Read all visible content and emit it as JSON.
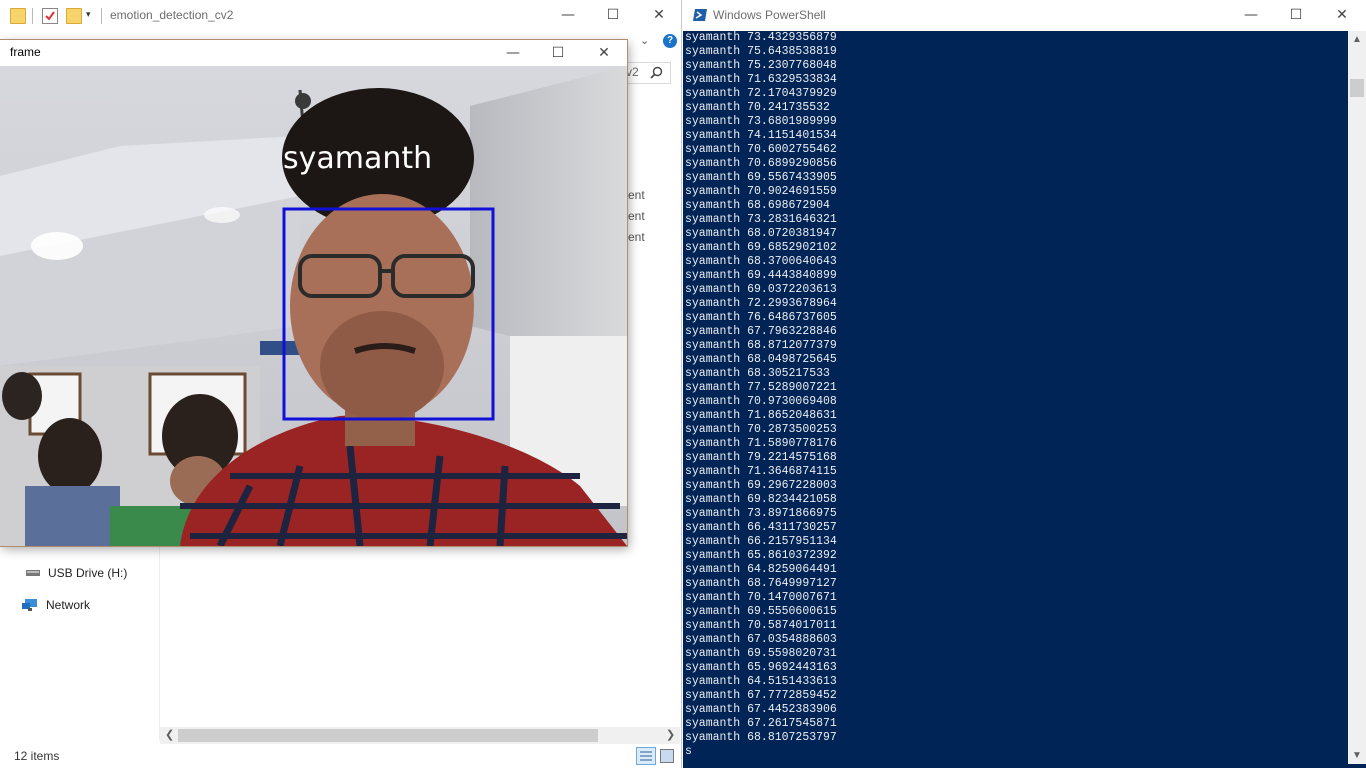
{
  "explorer": {
    "title": "emotion_detection_cv2",
    "address_tail": "v2",
    "file_peek": [
      "ent",
      "ent",
      "ent"
    ],
    "nav": [
      {
        "label": "USB Drive (H:)",
        "icon": "usb-drive-icon"
      },
      {
        "label": "Network",
        "icon": "network-icon"
      }
    ],
    "status": "12 items"
  },
  "frame": {
    "title": "frame",
    "face_label": "syamanth",
    "box_color": "#1010d8",
    "label_color": "#ffffff"
  },
  "powershell": {
    "title": "Windows PowerShell",
    "background": "#012456",
    "lines": [
      "syamanth 73.4329356879",
      "syamanth 75.6438538819",
      "syamanth 75.2307768048",
      "syamanth 71.6329533834",
      "syamanth 72.1704379929",
      "syamanth 70.241735532",
      "syamanth 73.6801989999",
      "syamanth 74.1151401534",
      "syamanth 70.6002755462",
      "syamanth 70.6899290856",
      "syamanth 69.5567433905",
      "syamanth 70.9024691559",
      "syamanth 68.698672904",
      "syamanth 73.2831646321",
      "syamanth 68.0720381947",
      "syamanth 69.6852902102",
      "syamanth 68.3700640643",
      "syamanth 69.4443840899",
      "syamanth 69.0372203613",
      "syamanth 72.2993678964",
      "syamanth 76.6486737605",
      "syamanth 67.7963228846",
      "syamanth 68.8712077379",
      "syamanth 68.0498725645",
      "syamanth 68.305217533",
      "syamanth 77.5289007221",
      "syamanth 70.9730069408",
      "syamanth 71.8652048631",
      "syamanth 70.2873500253",
      "syamanth 71.5890778176",
      "syamanth 79.2214575168",
      "syamanth 71.3646874115",
      "syamanth 69.2967228003",
      "syamanth 69.8234421058",
      "syamanth 73.8971866975",
      "syamanth 66.4311730257",
      "syamanth 66.2157951134",
      "syamanth 65.8610372392",
      "syamanth 64.8259064491",
      "syamanth 68.7649997127",
      "syamanth 70.1470007671",
      "syamanth 69.5550600615",
      "syamanth 70.5874017011",
      "syamanth 67.0354888603",
      "syamanth 69.5598020731",
      "syamanth 65.9692443163",
      "syamanth 64.5151433613",
      "syamanth 67.7772859452",
      "syamanth 67.4452383906",
      "syamanth 67.2617545871",
      "syamanth 68.8107253797",
      "s"
    ]
  }
}
